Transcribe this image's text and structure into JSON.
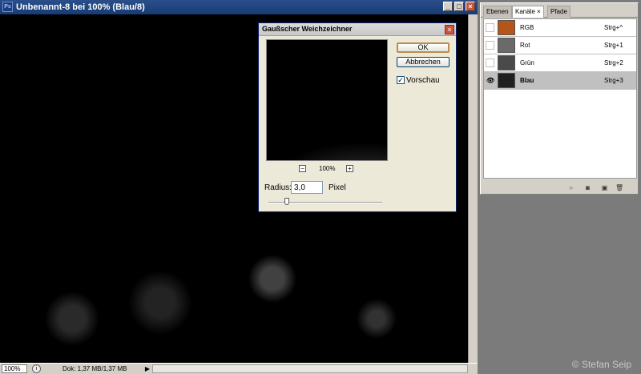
{
  "document": {
    "title": "Unbenannt-8 bei 100% (Blau/8)",
    "app_icon": "photoshop-icon",
    "status": {
      "zoom": "100%",
      "doc_info": "Dok: 1,37 MB/1,37 MB"
    }
  },
  "dialog": {
    "title": "Gaußscher Weichzeichner",
    "ok_label": "OK",
    "cancel_label": "Abbrechen",
    "preview_label": "Vorschau",
    "preview_checked": true,
    "zoom_level": "100%",
    "zoom_out": "−",
    "zoom_in": "+",
    "radius_label": "Radius:",
    "radius_value": "3,0",
    "radius_unit": "Pixel"
  },
  "panel": {
    "tabs": [
      {
        "label": "Ebenen",
        "active": false
      },
      {
        "label": "Kanäle ×",
        "active": true
      },
      {
        "label": "Pfade",
        "active": false
      }
    ],
    "channels": [
      {
        "name": "RGB",
        "shortcut": "Strg+^",
        "thumb_color": "#b4551a",
        "visible": false
      },
      {
        "name": "Rot",
        "shortcut": "Strg+1",
        "thumb_color": "#6a6a6a",
        "visible": false
      },
      {
        "name": "Grün",
        "shortcut": "Strg+2",
        "thumb_color": "#4a4a4a",
        "visible": false
      },
      {
        "name": "Blau",
        "shortcut": "Strg+3",
        "thumb_color": "#202020",
        "visible": true,
        "selected": true
      }
    ]
  },
  "copyright": "© Stefan Seip"
}
